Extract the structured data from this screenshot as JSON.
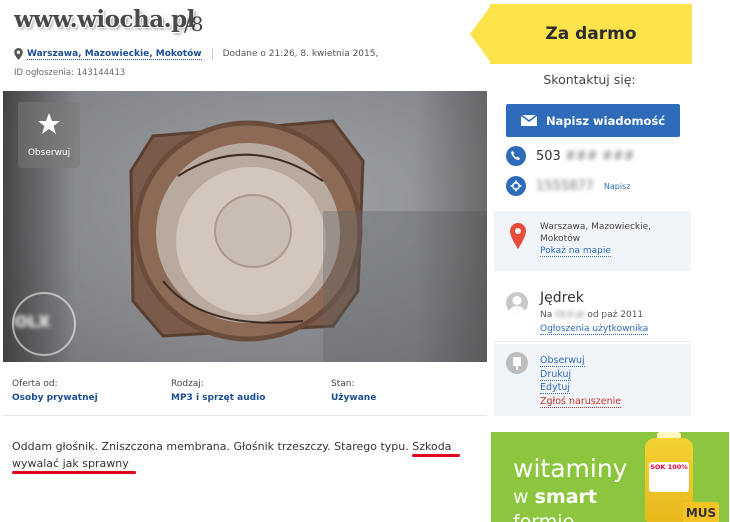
{
  "watermark": "www.wiocha.pl",
  "title_suffix": "/8",
  "location_link": "Warszawa, Mazowieckie, Mokotów",
  "added": "Dodane o 21:26, 8. kwietnia 2015,",
  "ad_id": "ID ogłoszenia: 143144413",
  "price": "Za darmo",
  "contact": {
    "title": "Skontaktuj się:",
    "message_button": "Napisz wiadomość",
    "phone_visible": "503",
    "phone_hidden": "### ###",
    "skype_hidden": "1555877",
    "skype_link": "Napisz"
  },
  "location_box": {
    "address": "Warszawa, Mazowieckie, Mokotów",
    "map_link": "Pokaż na mapie"
  },
  "user": {
    "name": "Jędrek",
    "since_prefix": "Na",
    "since_hidden": "OLX.pl",
    "since_suffix": "od paź 2011",
    "ads_link": "Ogłoszenia użytkownika"
  },
  "actions": [
    "Obserwuj",
    "Drukuj",
    "Edytuj",
    "Zgłoś naruszenie"
  ],
  "photo": {
    "follow_label": "Obserwuj",
    "blurred_logo": "OLX"
  },
  "details": [
    {
      "label": "Oferta od:",
      "value": "Osoby prywatnej"
    },
    {
      "label": "Rodzaj:",
      "value": "MP3 i sprzęt audio"
    },
    {
      "label": "Stan:",
      "value": "Używane"
    }
  ],
  "description": {
    "part1": "Oddam głośnik. Zniszczona membrana. Głośnik trzeszczy. Starego typu. ",
    "part2": "Szkoda",
    "part3": "wywalać jak sprawny"
  },
  "advert": {
    "line1": "witaminy",
    "line2_prefix": "w ",
    "line2_bold": "smart",
    "line3": "formie",
    "label": "SOK 100%",
    "brand": "MUS"
  },
  "colors": {
    "price_bg": "#fce34c",
    "primary_blue": "#2e6bb8",
    "highlight_red": "#e0001b",
    "ad_green": "#8cc63e"
  }
}
